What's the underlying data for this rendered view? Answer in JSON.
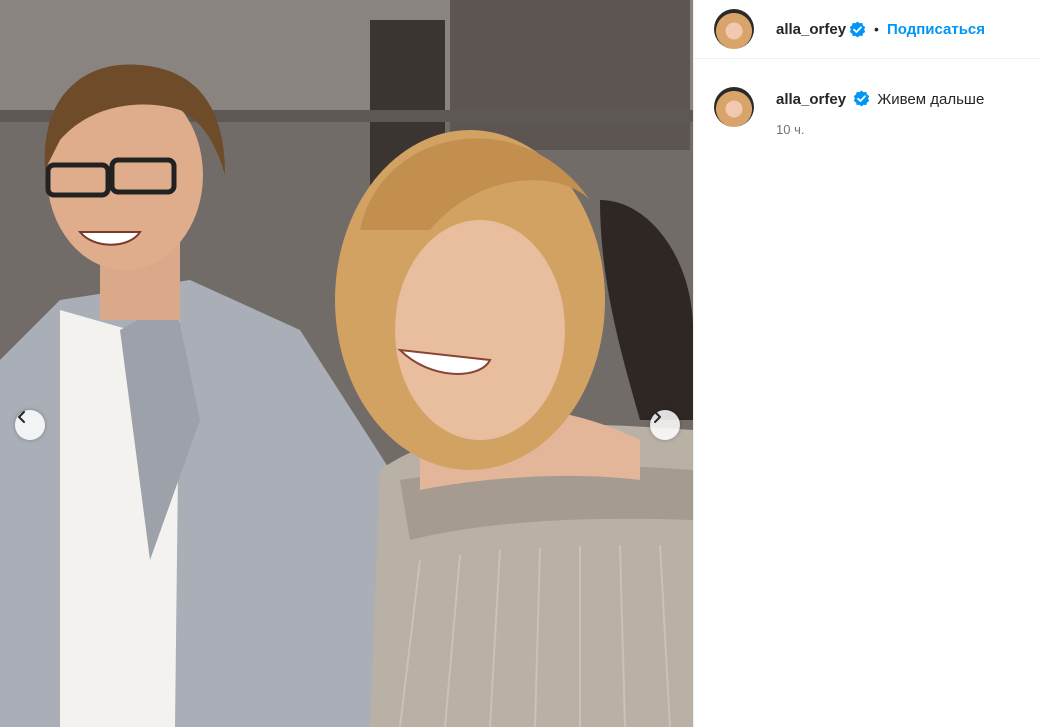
{
  "post": {
    "username": "alla_orfey",
    "follow_label": "Подписаться",
    "separator": "•",
    "caption_text": "Живем дальше",
    "time_ago": "10 ч."
  },
  "icons": {
    "verified": "verified-badge-icon",
    "prev": "chevron-left-icon",
    "next": "chevron-right-icon"
  },
  "colors": {
    "accent": "#0095f6",
    "text": "#262626",
    "muted": "#737373"
  }
}
